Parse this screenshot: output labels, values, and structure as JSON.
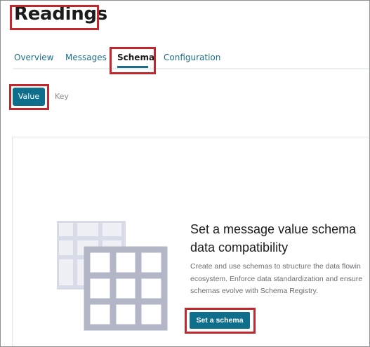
{
  "header": {
    "title": "Readings"
  },
  "tabs": [
    {
      "label": "Overview",
      "active": false
    },
    {
      "label": "Messages",
      "active": false
    },
    {
      "label": "Schema",
      "active": true
    },
    {
      "label": "Configuration",
      "active": false
    }
  ],
  "schema_toggle": {
    "value_label": "Value",
    "key_label": "Key",
    "selected": "Value"
  },
  "empty_state": {
    "heading": "Set a message value schema\ndata compatibility",
    "description": "Create and use schemas to structure the data flowin\necosystem. Enforce data standardization and ensure\nschemas evolve with Schema Registry.",
    "button_label": "Set a schema",
    "icon": "table-schema-illustration"
  },
  "colors": {
    "accent": "#0e6e8c",
    "highlight": "#c1272d",
    "link": "#1b6e8a"
  }
}
